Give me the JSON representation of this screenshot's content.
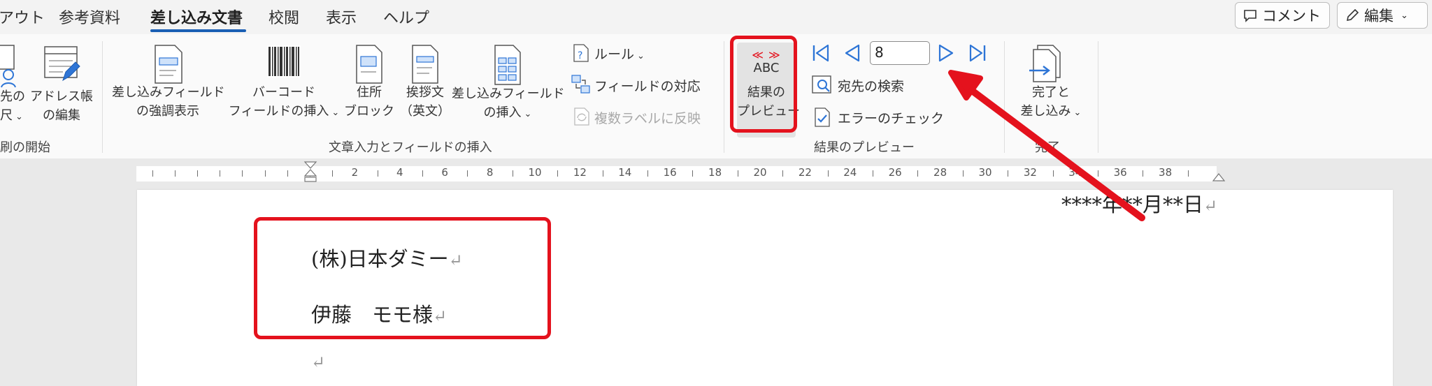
{
  "tabs": [
    "アウト",
    "参考資料",
    "差し込み文書",
    "校閲",
    "表示",
    "ヘルプ"
  ],
  "active_tab": "差し込み文書",
  "top_buttons": {
    "comment": "コメント",
    "edit": "編集"
  },
  "ribbon": {
    "start_group": {
      "recipient_label_1": "先の",
      "recipient_label_2": "尺",
      "address_book_1": "アドレス帳",
      "address_book_2": "の編集",
      "group_label": "刷の開始"
    },
    "insert_group": {
      "highlight_1": "差し込みフィールド",
      "highlight_2": "の強調表示",
      "barcode_1": "バーコード",
      "barcode_2": "フィールドの挿入",
      "address_1": "住所",
      "address_2": "ブロック",
      "greeting_1": "挨拶文",
      "greeting_2": "（英文）",
      "merge_field_1": "差し込みフィールド",
      "merge_field_2": "の挿入",
      "rules": "ルール",
      "match_fields": "フィールドの対応",
      "update_labels": "複数ラベルに反映",
      "group_label": "文章入力とフィールドの挿入"
    },
    "preview_group": {
      "abc": "ABC",
      "preview_1": "結果の",
      "preview_2": "プレビュー",
      "record_number": "8",
      "find_recipient": "宛先の検索",
      "check_errors": "エラーのチェック",
      "group_label": "結果のプレビュー"
    },
    "finish_group": {
      "finish_1": "完了と",
      "finish_2": "差し込み",
      "group_label": "完了"
    }
  },
  "ruler": {
    "ticks": [
      "2",
      "4",
      "6",
      "8",
      "10",
      "12",
      "14",
      "16",
      "18",
      "20",
      "22",
      "24",
      "26",
      "28",
      "30",
      "32",
      "34",
      "36",
      "38"
    ]
  },
  "document": {
    "date": "****年**月**日",
    "company": "(株)日本ダミー",
    "name": "伊藤　モモ様",
    "paragraph_mark": "↵"
  },
  "colors": {
    "highlight": "#e4121d",
    "accent": "#1a5fb4",
    "icon_blue": "#2e75d6"
  }
}
